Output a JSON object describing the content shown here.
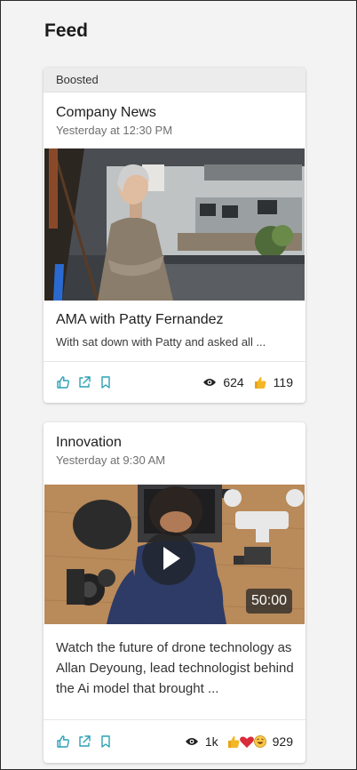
{
  "page": {
    "title": "Feed"
  },
  "posts": [
    {
      "boosted_label": "Boosted",
      "channel": "Company News",
      "timestamp": "Yesterday at 12:30 PM",
      "heading": "AMA with Patty Fernandez",
      "excerpt": "With sat down with Patty and asked all ...",
      "views": "624",
      "likes": "119",
      "action_icons": [
        "thumb-up-icon",
        "share-icon",
        "bookmark-icon"
      ]
    },
    {
      "channel": "Innovation",
      "timestamp": "Yesterday at 9:30 AM",
      "body": "Watch the future of drone technology as Allan Deyoung, lead technologist behind the Ai model that brought ...",
      "video_duration": "50:00",
      "views": "1k",
      "reactions": "929",
      "reaction_icons": [
        "thumb-up-icon",
        "heart-icon",
        "laugh-icon"
      ],
      "action_icons": [
        "thumb-up-icon",
        "share-icon",
        "bookmark-icon"
      ]
    }
  ],
  "colors": {
    "accent": "#2aa0b6",
    "like": "#e8a317",
    "heart": "#d92c3b"
  }
}
